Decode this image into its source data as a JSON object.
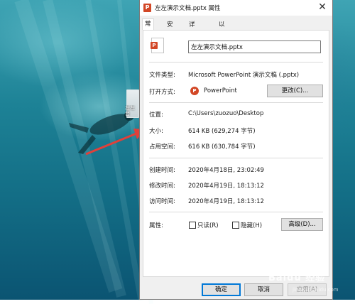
{
  "window": {
    "title": "左左演示文档.pptx 属性",
    "close_glyph": "✕"
  },
  "tabs": [
    {
      "label": "常规",
      "active": true
    },
    {
      "label": "安全",
      "active": false
    },
    {
      "label": "详细信息",
      "active": false
    },
    {
      "label": "以前的版本",
      "active": false
    }
  ],
  "general": {
    "filename": "左左演示文档.pptx",
    "file_type_label": "文件类型:",
    "file_type_value": "Microsoft PowerPoint 演示文稿 (.pptx)",
    "opens_with_label": "打开方式:",
    "opens_with_app": "PowerPoint",
    "change_button": "更改(C)...",
    "location_label": "位置:",
    "location_value": "C:\\Users\\zuozuo\\Desktop",
    "size_label": "大小:",
    "size_value": "614 KB (629,274 字节)",
    "size_on_disk_label": "占用空间:",
    "size_on_disk_value": "616 KB (630,784 字节)",
    "created_label": "创建时间:",
    "created_value": "2020年4月18日, 23:02:49",
    "modified_label": "修改时间:",
    "modified_value": "2020年4月19日, 18:13:12",
    "accessed_label": "访问时间:",
    "accessed_value": "2020年4月19日, 18:13:12",
    "attributes_label": "属性:",
    "readonly_label": "只读(R)",
    "readonly_checked": false,
    "hidden_label": "隐藏(H)",
    "hidden_checked": false,
    "advanced_button": "高级(D)..."
  },
  "footer": {
    "ok": "确定",
    "cancel": "取消",
    "apply": "应用(A)"
  },
  "desktop_icon_label": "左左 台",
  "watermark": "Baidu 经验",
  "watermark_sub": "jingyan.baidu.com",
  "colors": {
    "accent_arrow": "#e0403a",
    "pptx_brand": "#d24726",
    "dialog_bg": "#f0f0f0"
  }
}
